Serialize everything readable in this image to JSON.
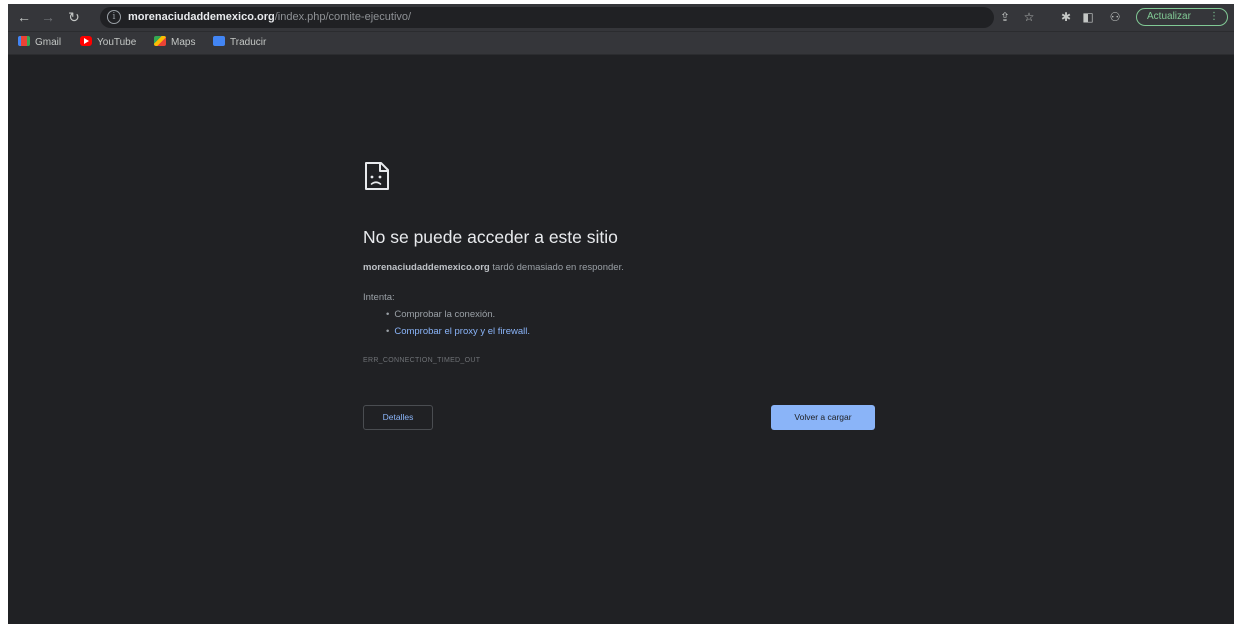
{
  "browser": {
    "url_host": "morenaciudaddemexico.org",
    "url_path": "/index.php/comite-ejecutivo/",
    "update_label": "Actualizar",
    "update_menu_glyph": "⋮"
  },
  "bookmarks": [
    {
      "label": "Gmail",
      "icon": "gmail-icon"
    },
    {
      "label": "YouTube",
      "icon": "youtube-icon"
    },
    {
      "label": "Maps",
      "icon": "maps-icon"
    },
    {
      "label": "Traducir",
      "icon": "translate-icon"
    }
  ],
  "error": {
    "title": "No se puede acceder a este sitio",
    "host": "morenaciudaddemexico.org",
    "message": " tardó demasiado en responder.",
    "try_label": "Intenta:",
    "suggestions": [
      "Comprobar la conexión.",
      "Comprobar el proxy y el firewall."
    ],
    "code": "ERR_CONNECTION_TIMED_OUT",
    "details_label": "Detalles",
    "reload_label": "Volver a cargar"
  },
  "colors": {
    "page_background": "#202124",
    "toolbar": "#35363a",
    "link": "#8ab4f8",
    "update_accent": "#81c995"
  }
}
